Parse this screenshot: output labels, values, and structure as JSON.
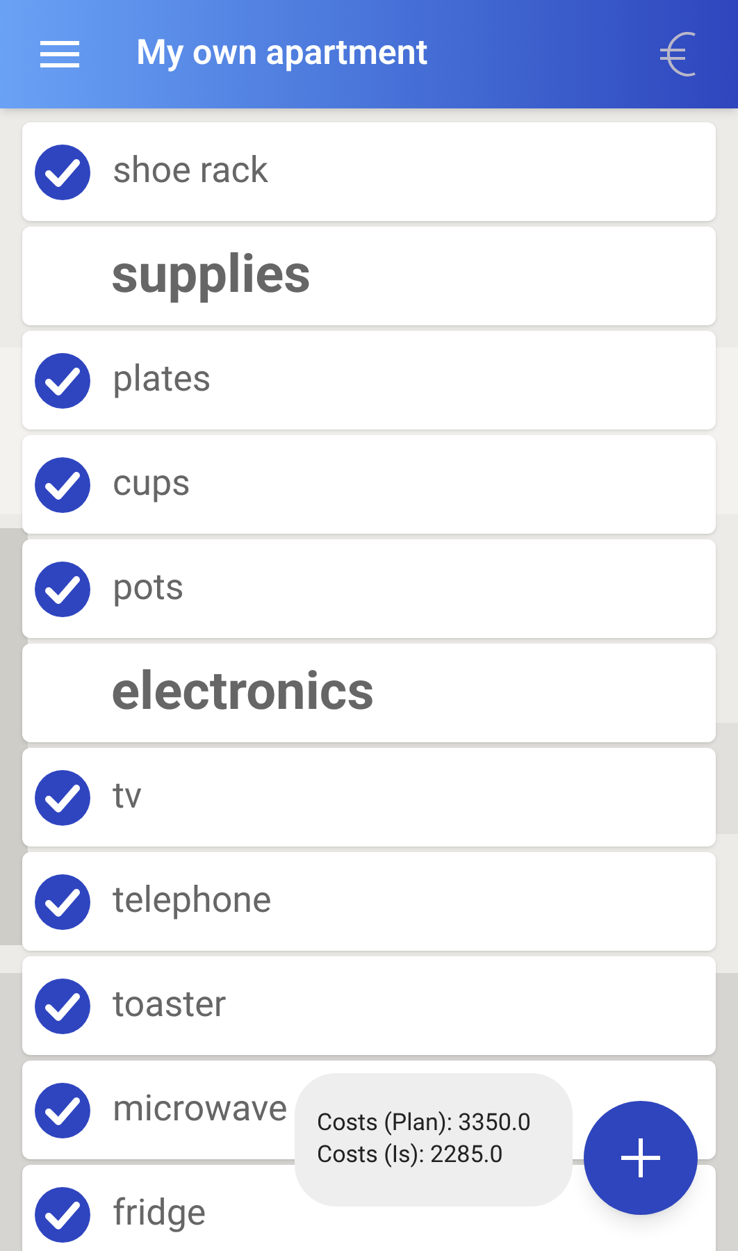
{
  "app_bar": {
    "title": "My own apartment"
  },
  "list": [
    {
      "kind": "item",
      "label": "shoe rack",
      "checked": true
    },
    {
      "kind": "category",
      "label": "supplies"
    },
    {
      "kind": "item",
      "label": "plates",
      "checked": true
    },
    {
      "kind": "item",
      "label": "cups",
      "checked": true
    },
    {
      "kind": "item",
      "label": "pots",
      "checked": true
    },
    {
      "kind": "category",
      "label": "electronics"
    },
    {
      "kind": "item",
      "label": "tv",
      "checked": true
    },
    {
      "kind": "item",
      "label": "telephone",
      "checked": true
    },
    {
      "kind": "item",
      "label": "toaster",
      "checked": true
    },
    {
      "kind": "item",
      "label": "microwave",
      "checked": true
    },
    {
      "kind": "item",
      "label": "fridge",
      "checked": true
    }
  ],
  "toast": [
    "Costs (Plan): 3350.0",
    "Costs (Is): 2285.0"
  ]
}
